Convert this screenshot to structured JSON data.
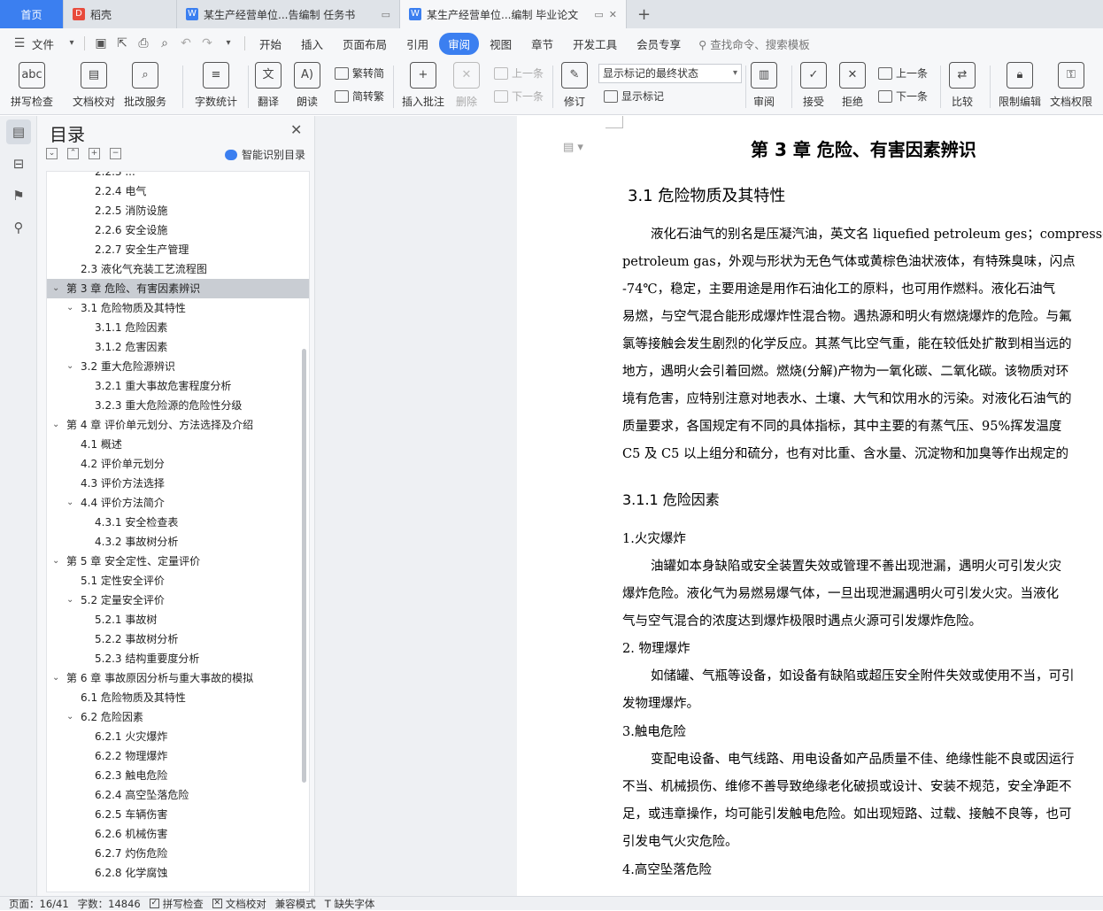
{
  "tabs": [
    {
      "label": "首页",
      "kind": "home"
    },
    {
      "label": "稻壳",
      "icon": "daoke-icon",
      "icon_color": "#e84b3c"
    },
    {
      "label": "某生产经营单位...告编制 任务书",
      "icon": "wps-writer-icon",
      "icon_color": "#3b7ff0"
    },
    {
      "label": "某生产经营单位...编制 毕业论文",
      "icon": "wps-writer-icon",
      "icon_color": "#3b7ff0",
      "active": true
    }
  ],
  "menu": {
    "file": "文件",
    "items": [
      "开始",
      "插入",
      "页面布局",
      "引用",
      "审阅",
      "视图",
      "章节",
      "开发工具",
      "会员专享"
    ],
    "active": "审阅",
    "search": "查找命令、搜索模板"
  },
  "ribbon": {
    "spell_check": "拼写检查",
    "doc_proof": "文档校对",
    "batch_service": "批改服务",
    "word_count": "字数统计",
    "translate": "翻译",
    "read_aloud": "朗读",
    "trad_to_simp": "繁转简",
    "simp_to_trad": "简转繁",
    "insert_comment": "插入批注",
    "delete": "删除",
    "prev": "上一条",
    "next": "下一条",
    "track_changes": "修订",
    "markup_mode": "显示标记的最终状态",
    "show_markup": "显示标记",
    "review": "审阅",
    "accept": "接受",
    "reject": "拒绝",
    "prev2": "上一条",
    "next2": "下一条",
    "compare": "比较",
    "restrict_edit": "限制编辑",
    "doc_permission": "文档权限"
  },
  "toc": {
    "title": "目录",
    "smart": "智能识别目录",
    "items": [
      {
        "label": "2.2.3 ...",
        "level": 3
      },
      {
        "label": "2.2.4 电气",
        "level": 3
      },
      {
        "label": "2.2.5 消防设施",
        "level": 3
      },
      {
        "label": "2.2.6 安全设施",
        "level": 3
      },
      {
        "label": "2.2.7 安全生产管理",
        "level": 3
      },
      {
        "label": "2.3  液化气充装工艺流程图",
        "level": 2
      },
      {
        "label": "第 3 章  危险、有害因素辨识",
        "level": 1,
        "expanded": true,
        "selected": true
      },
      {
        "label": "3.1  危险物质及其特性",
        "level": 2,
        "expanded": true
      },
      {
        "label": "3.1.1 危险因素",
        "level": 3
      },
      {
        "label": "3.1.2 危害因素",
        "level": 3
      },
      {
        "label": "3.2 重大危险源辨识",
        "level": 2,
        "expanded": true
      },
      {
        "label": "3.2.1 重大事故危害程度分析",
        "level": 3
      },
      {
        "label": "3.2.3 重大危险源的危险性分级",
        "level": 3
      },
      {
        "label": "第 4 章  评价单元划分、方法选择及介绍",
        "level": 1,
        "expanded": true
      },
      {
        "label": "4.1  概述",
        "level": 2
      },
      {
        "label": "4.2  评价单元划分",
        "level": 2
      },
      {
        "label": "4.3  评价方法选择",
        "level": 2
      },
      {
        "label": "4.4  评价方法简介",
        "level": 2,
        "expanded": true
      },
      {
        "label": "4.3.1  安全检查表",
        "level": 3
      },
      {
        "label": "4.3.2  事故树分析",
        "level": 3
      },
      {
        "label": "第 5 章  安全定性、定量评价",
        "level": 1,
        "expanded": true
      },
      {
        "label": "5.1 定性安全评价",
        "level": 2
      },
      {
        "label": "5.2 定量安全评价",
        "level": 2,
        "expanded": true
      },
      {
        "label": "5.2.1  事故树",
        "level": 3
      },
      {
        "label": "5.2.2  事故树分析",
        "level": 3
      },
      {
        "label": "5.2.3  结构重要度分析",
        "level": 3
      },
      {
        "label": "第 6 章  事故原因分析与重大事故的模拟",
        "level": 1,
        "expanded": true
      },
      {
        "label": "6.1 危险物质及其特性",
        "level": 2
      },
      {
        "label": "6.2 危险因素",
        "level": 2,
        "expanded": true
      },
      {
        "label": "6.2.1 火灾爆炸",
        "level": 3
      },
      {
        "label": "6.2.2 物理爆炸",
        "level": 3
      },
      {
        "label": "6.2.3 触电危险",
        "level": 3
      },
      {
        "label": "6.2.4 高空坠落危险",
        "level": 3
      },
      {
        "label": "6.2.5 车辆伤害",
        "level": 3
      },
      {
        "label": "6.2.6 机械伤害",
        "level": 3
      },
      {
        "label": "6.2.7 灼伤危险",
        "level": 3
      },
      {
        "label": "6.2.8 化学腐蚀",
        "level": 3
      }
    ]
  },
  "document": {
    "chapter_title": "第 3 章  危险、有害因素辨识",
    "section_title": "3.1  危险物质及其特性",
    "para1": [
      "液化石油气的别名是压凝汽油，英文名 liquefied petroleum ges；compresse",
      "petroleum gas，外观与形状为无色气体或黄棕色油状液体，有特殊臭味，闪点",
      "-74℃，稳定，主要用途是用作石油化工的原料，也可用作燃料。液化石油气",
      "易燃，与空气混合能形成爆炸性混合物。遇热源和明火有燃烧爆炸的危险。与氟",
      "氯等接触会发生剧烈的化学反应。其蒸气比空气重，能在较低处扩散到相当远的",
      "地方，遇明火会引着回燃。燃烧(分解)产物为一氧化碳、二氧化碳。该物质对环",
      "境有危害，应特别注意对地表水、土壤、大气和饮用水的污染。对液化石油气的",
      "质量要求，各国规定有不同的具体指标，其中主要的有蒸气压、95%挥发温度",
      "C5 及 C5 以上组分和硫分，也有对比重、含水量、沉淀物和加臭等作出规定的"
    ],
    "subsection_title": "3.1.1 危险因素",
    "item1_title": "1.火灾爆炸",
    "item1": [
      "油罐如本身缺陷或安全装置失效或管理不善出现泄漏，遇明火可引发火灾",
      "爆炸危险。液化气为易燃易爆气体，一旦出现泄漏遇明火可引发火灾。当液化",
      "气与空气混合的浓度达到爆炸极限时遇点火源可引发爆炸危险。"
    ],
    "item2_title": "2.  物理爆炸",
    "item2": [
      "如储罐、气瓶等设备，如设备有缺陷或超压安全附件失效或使用不当，可引",
      "发物理爆炸。"
    ],
    "item3_title": "3.触电危险",
    "item3": [
      "变配电设备、电气线路、用电设备如产品质量不佳、绝缘性能不良或因运行",
      "不当、机械损伤、维修不善导致绝缘老化破损或设计、安装不规范，安全净距不",
      "足，或违章操作，均可能引发触电危险。如出现短路、过载、接触不良等，也可",
      "引发电气火灾危险。"
    ],
    "item4_title": "4.高空坠落危险"
  },
  "status": {
    "page": "页面：16/41",
    "words": "字数：14846",
    "spell": "拼写检查",
    "proof": "文档校对",
    "compat": "兼容模式",
    "missing_font": "缺失字体"
  }
}
